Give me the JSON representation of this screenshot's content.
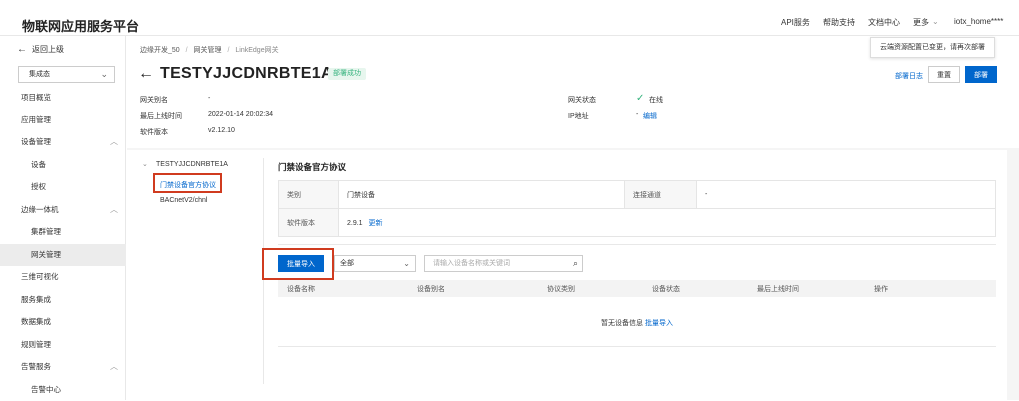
{
  "app": {
    "title": "物联网应用服务平台"
  },
  "topnav": {
    "api": "API服务",
    "help": "帮助支持",
    "docs": "文档中心",
    "more": "更多",
    "user": "iotx_home****"
  },
  "sidebar": {
    "back": "返回上级",
    "select_value": "集成态",
    "items": [
      "项目概览",
      "应用管理",
      "设备管理",
      "设备",
      "授权",
      "边缘一体机",
      "集群管理",
      "网关管理",
      "三维可视化",
      "服务集成",
      "数据集成",
      "规则管理",
      "告警服务",
      "告警中心"
    ]
  },
  "breadcrumb": {
    "c1": "边缘开发_50",
    "sep": "/",
    "c2": "网关管理",
    "c3": "LinkEdge网关"
  },
  "gateway": {
    "name": "TESTYJJCDNRBTE1A",
    "badge": "部署成功"
  },
  "meta": {
    "alias_k": "网关别名",
    "alias_v": "-",
    "online_k": "最后上线时间",
    "online_v": "2022-01-14 20:02:34",
    "ver_k": "软件版本",
    "ver_v": "v2.12.10",
    "status_k": "网关状态",
    "status_v": "在线",
    "ip_k": "IP地址",
    "ip_v": "-",
    "ip_edit": "编辑"
  },
  "actions": {
    "log": "部署日志",
    "reset": "重置",
    "deploy": "部署",
    "tooltip": "云端资源配置已变更，请再次部署"
  },
  "tree": {
    "root": "TESTYJJCDNRBTE1A",
    "n1": "门禁设备官方协议",
    "n2": "BACnetV2/chnl"
  },
  "protocol": {
    "title": "门禁设备官方协议",
    "type_k": "类别",
    "type_v": "门禁设备",
    "channel_k": "连接通道",
    "channel_v": "-",
    "ver_k": "软件版本",
    "ver_v": "2.9.1",
    "update": "更新"
  },
  "toolbar": {
    "import": "批量导入",
    "filter": "全部",
    "search_ph": "请输入设备名称或关键词"
  },
  "table": {
    "headers": [
      "设备名称",
      "设备别名",
      "协议类别",
      "设备状态",
      "最后上线时间",
      "操作"
    ],
    "empty": "暂无设备信息",
    "empty_link": "批量导入"
  },
  "colors": {
    "primary": "#0066cc",
    "success": "#36b37e",
    "highlight": "#d03b1f"
  }
}
